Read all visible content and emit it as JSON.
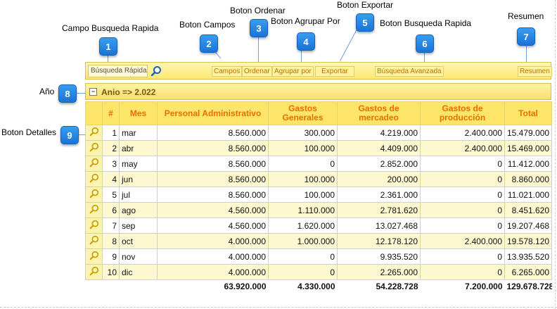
{
  "callouts": {
    "c1": {
      "num": "1",
      "label": "Campo Busqueda Rapida"
    },
    "c2": {
      "num": "2",
      "label": "Boton Campos"
    },
    "c3": {
      "num": "3",
      "label": "Boton Ordenar"
    },
    "c4": {
      "num": "4",
      "label": "Boton Agrupar Por"
    },
    "c5": {
      "num": "5",
      "label": "Boton Exportar"
    },
    "c6": {
      "num": "6",
      "label": "Boton Busqueda Rapida"
    },
    "c7": {
      "num": "7",
      "label": "Resumen"
    },
    "c8": {
      "num": "8",
      "label": "Año"
    },
    "c9": {
      "num": "9",
      "label": "Boton Detalles"
    }
  },
  "toolbar": {
    "search_placeholder": "Búsqueda Rápida",
    "campos": "Campos",
    "ordenar": "Ordenar",
    "agrupar": "Agrupar por",
    "exportar": "Exportar",
    "avanzada": "Búsqueda Avanzada",
    "resumen": "Resumen"
  },
  "group": {
    "toggle": "−",
    "label": "Anio => 2.022"
  },
  "columns": [
    "#",
    "Mes",
    "Personal Administrativo",
    "Gastos Generales",
    "Gastos de mercadeo",
    "Gastos de producción",
    "Total"
  ],
  "rows": [
    [
      "1",
      "mar",
      "8.560.000",
      "300.000",
      "4.219.000",
      "2.400.000",
      "15.479.000"
    ],
    [
      "2",
      "abr",
      "8.560.000",
      "100.000",
      "4.409.000",
      "2.400.000",
      "15.469.000"
    ],
    [
      "3",
      "may",
      "8.560.000",
      "0",
      "2.852.000",
      "0",
      "11.412.000"
    ],
    [
      "4",
      "jun",
      "8.560.000",
      "100.000",
      "200.000",
      "0",
      "8.860.000"
    ],
    [
      "5",
      "jul",
      "8.560.000",
      "100.000",
      "2.361.000",
      "0",
      "11.021.000"
    ],
    [
      "6",
      "ago",
      "4.560.000",
      "1.110.000",
      "2.781.620",
      "0",
      "8.451.620"
    ],
    [
      "7",
      "sep",
      "4.560.000",
      "1.620.000",
      "13.027.468",
      "0",
      "19.207.468"
    ],
    [
      "8",
      "oct",
      "4.000.000",
      "1.000.000",
      "12.178.120",
      "2.400.000",
      "19.578.120"
    ],
    [
      "9",
      "nov",
      "4.000.000",
      "0",
      "9.935.520",
      "0",
      "13.935.520"
    ],
    [
      "10",
      "dic",
      "4.000.000",
      "0",
      "2.265.000",
      "0",
      "6.265.000"
    ]
  ],
  "totals": [
    "63.920.000",
    "4.330.000",
    "54.228.728",
    "7.200.000",
    "129.678.728"
  ],
  "icons": {
    "detail": "magnifier-icon",
    "search": "magnifier-icon"
  },
  "colors": {
    "badge": "#1a73d6",
    "header_text": "#e86e00",
    "toolbar": "#fde872"
  }
}
